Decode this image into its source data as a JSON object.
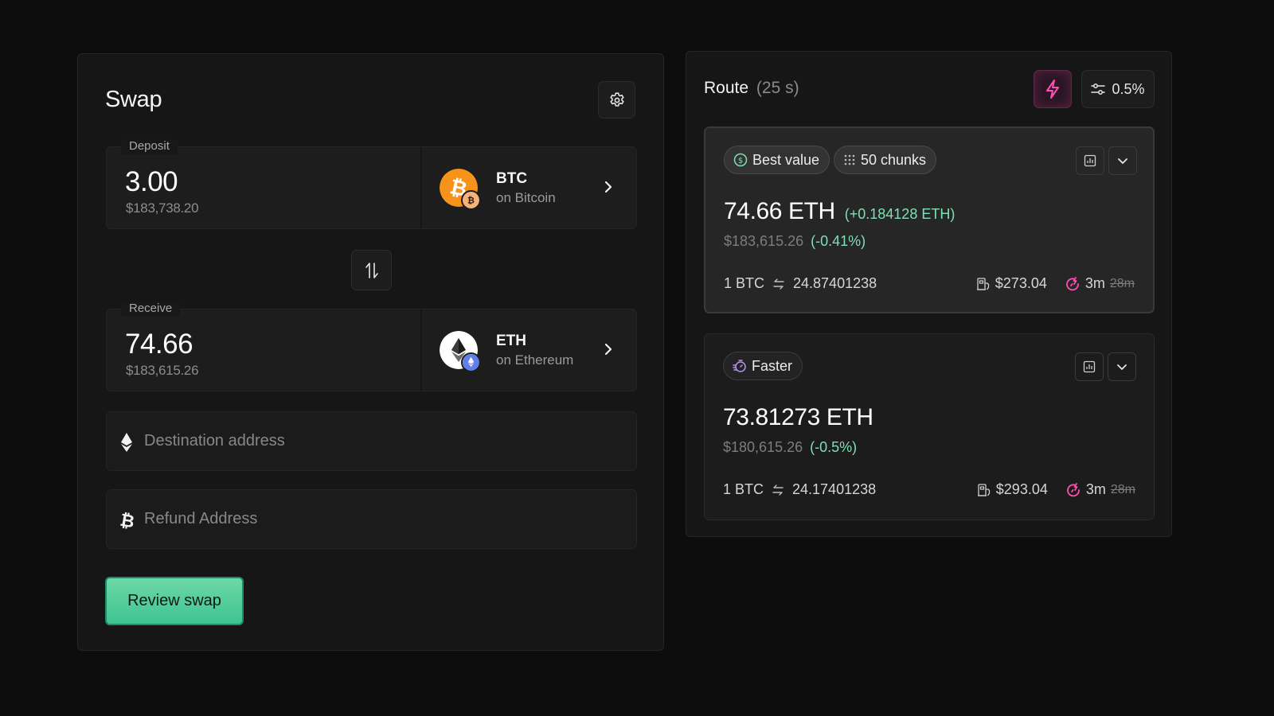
{
  "swap": {
    "title": "Swap",
    "settings_icon": "gear-icon",
    "deposit": {
      "label": "Deposit",
      "amount": "3.00",
      "usd_value": "$183,738.20",
      "token_symbol": "BTC",
      "token_chain": "on Bitcoin",
      "token_color": "#f7931a"
    },
    "flip_icon": "swap-vertical-arrows-icon",
    "receive": {
      "label": "Receive",
      "amount": "74.66",
      "usd_value": "$183,615.26",
      "token_symbol": "ETH",
      "token_chain": "on Ethereum",
      "chain_badge_color": "#627eea"
    },
    "destination_address": {
      "value": "",
      "placeholder": "Destination address",
      "icon": "ethereum-icon"
    },
    "refund_address": {
      "value": "",
      "placeholder": "Refund Address",
      "icon": "bitcoin-icon"
    },
    "review_button_label": "Review swap",
    "accent_color": "#4fcc9a"
  },
  "route": {
    "title": "Route",
    "refresh_timer": "(25 s)",
    "flash_icon": "lightning-icon",
    "flash_color": "#ec4899",
    "slippage": "0.5%",
    "options": [
      {
        "tags": [
          {
            "icon": "dollar-circle-icon",
            "label": "Best value"
          },
          {
            "icon": "dots-grid-icon",
            "label": "50 chunks"
          }
        ],
        "amount": "74.66 ETH",
        "amount_delta": "(+0.184128 ETH)",
        "usd_value": "$183,615.26",
        "usd_change": "(-0.41%)",
        "rate_from": "1 BTC",
        "rate_to": "24.87401238",
        "gas_fee": "$273.04",
        "eta": "3m",
        "eta_previous": "28m",
        "selected": true
      },
      {
        "tags": [
          {
            "icon": "stopwatch-icon",
            "label": "Faster"
          }
        ],
        "amount": "73.81273 ETH",
        "amount_delta": "",
        "usd_value": "$180,615.26",
        "usd_change": "(-0.5%)",
        "rate_from": "1 BTC",
        "rate_to": "24.17401238",
        "gas_fee": "$293.04",
        "eta": "3m",
        "eta_previous": "28m",
        "selected": false
      }
    ]
  }
}
